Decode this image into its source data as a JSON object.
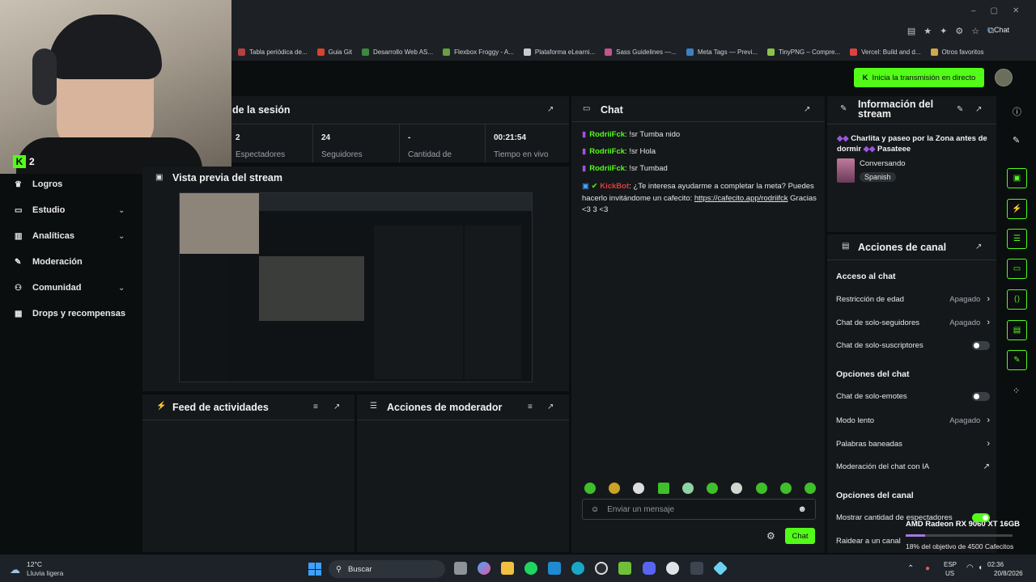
{
  "browser": {
    "chat_pill": "Chat",
    "bookmarks": [
      {
        "label": "Tabla periódica de...",
        "color": "#b84040"
      },
      {
        "label": "Guia Git",
        "color": "#d8432c"
      },
      {
        "label": "Desarrollo Web AS...",
        "color": "#3c8a3c"
      },
      {
        "label": "Flexbox Froggy - A...",
        "color": "#66a040"
      },
      {
        "label": "Plataforma eLearni...",
        "color": "#cccccc"
      },
      {
        "label": "Sass Guidelines —...",
        "color": "#c6538c"
      },
      {
        "label": "Meta Tags — Previ...",
        "color": "#3b82c4"
      },
      {
        "label": "TinyPNG – Compre...",
        "color": "#8bc34a"
      },
      {
        "label": "Vercel: Build and d...",
        "color": "#e04040"
      },
      {
        "label": "Otros favoritos",
        "color": "#cfa84a"
      }
    ]
  },
  "kick": {
    "start_stream_label": "Inicia la transmisión en directo",
    "webcam_badge": "2",
    "sidebar": {
      "items": [
        {
          "label": "Logros",
          "icon": "trophy-icon",
          "chevron": false
        },
        {
          "label": "Estudio",
          "icon": "monitor-icon",
          "chevron": true
        },
        {
          "label": "Analíticas",
          "icon": "chart-icon",
          "chevron": true
        },
        {
          "label": "Moderación",
          "icon": "wrench-icon",
          "chevron": false
        },
        {
          "label": "Comunidad",
          "icon": "users-icon",
          "chevron": true
        },
        {
          "label": "Drops y recompensas",
          "icon": "gift-icon",
          "chevron": false
        }
      ]
    },
    "session": {
      "title": "de la sesión",
      "stats": [
        {
          "value": "2",
          "label": "Espectadores"
        },
        {
          "value": "24",
          "label": "Seguidores"
        },
        {
          "value": "-",
          "label": "Cantidad de"
        },
        {
          "value": "00:21:54",
          "label": "Tiempo en vivo"
        }
      ]
    },
    "preview": {
      "title": "Vista previa del stream"
    },
    "feed": {
      "title": "Feed de actividades"
    },
    "mod_actions": {
      "title": "Acciones de moderador"
    },
    "chat": {
      "title": "Chat",
      "messages": [
        {
          "user": "RodriiFck",
          "text": ": !sr Tumba nido"
        },
        {
          "user": "RodriiFck",
          "text": ": !sr Hola"
        },
        {
          "user": "RodriiFck",
          "text": ": !sr Tumbad"
        }
      ],
      "bot": {
        "user": "KickBot",
        "text": ": ¿Te interesa ayudarme a completar la meta? Puedes hacerlo invitándome un cafecito:",
        "link": "https://cafecito.app/rodriifck",
        "tail": " Gracias <3 ",
        "tail2": "3 <3"
      },
      "input_placeholder": "Enviar un mensaje",
      "send_label": "Chat"
    },
    "stream_info": {
      "title": "Información del stream",
      "stream_title": "Charlita y paseo por la Zona antes de dormir",
      "stream_title_tail": "Pasateee",
      "category": "Conversando",
      "language": "Spanish"
    },
    "channel_actions": {
      "title": "Acciones de canal",
      "chat_access": {
        "heading": "Acceso al chat",
        "rows": [
          {
            "label": "Restricción de edad",
            "value": "Apagado",
            "kind": "chevron"
          },
          {
            "label": "Chat de solo-seguidores",
            "value": "Apagado",
            "kind": "chevron"
          },
          {
            "label": "Chat de solo-suscriptores",
            "value": "",
            "kind": "toggle-off"
          }
        ]
      },
      "chat_options": {
        "heading": "Opciones del chat",
        "rows": [
          {
            "label": "Chat de solo-emotes",
            "value": "",
            "kind": "toggle-off"
          },
          {
            "label": "Modo lento",
            "value": "Apagado",
            "kind": "chevron"
          },
          {
            "label": "Palabras baneadas",
            "value": "",
            "kind": "chevron"
          },
          {
            "label": "Moderación del chat con IA",
            "value": "",
            "kind": "external"
          }
        ]
      },
      "channel_options": {
        "heading": "Opciones del canal",
        "rows": [
          {
            "label": "Mostrar cantidad de espectadores",
            "value": "",
            "kind": "toggle-on"
          },
          {
            "label": "Raidear a un canal",
            "value": "",
            "kind": "none"
          }
        ]
      }
    },
    "overlay": {
      "gpu": "AMD Radeon RX 9060 XT 16GB",
      "goal": "18% del objetivo de 4500 Cafecitos",
      "goal_progress": 0.18
    }
  },
  "taskbar": {
    "weather_temp": "12°C",
    "weather_desc": "Lluvia ligera",
    "search_label": "Buscar",
    "lang": "ESP",
    "region": "US",
    "time": "02:36",
    "date": "20/8/2026"
  }
}
